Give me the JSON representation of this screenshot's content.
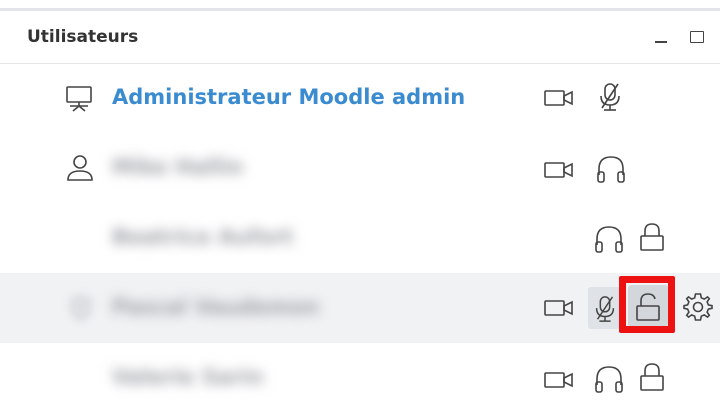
{
  "panel": {
    "title": "Utilisateurs",
    "controls": {
      "minimize": "minimize-icon",
      "maximize": "maximize-icon"
    }
  },
  "users": [
    {
      "name": "Administrateur Moodle admin",
      "role_icon": "presenter-icon",
      "name_visible": true,
      "actions": [
        "camera-icon",
        "microphone-muted-icon"
      ]
    },
    {
      "name": "Mike Hallin",
      "role_icon": "user-icon",
      "name_visible": false,
      "actions": [
        "camera-icon",
        "headphones-icon"
      ]
    },
    {
      "name": "Beatrice Aufort",
      "role_icon": "",
      "name_visible": false,
      "actions": [
        "headphones-icon",
        "lock-icon"
      ]
    },
    {
      "name": "Pascal Vaudemon",
      "role_icon": "shield-icon",
      "name_visible": false,
      "actions": [
        "camera-icon",
        "microphone-muted-icon",
        "unlock-icon",
        "gear-icon"
      ]
    },
    {
      "name": "Valerie Sarin",
      "role_icon": "",
      "name_visible": false,
      "actions": [
        "camera-icon",
        "headphones-icon",
        "lock-icon"
      ]
    }
  ],
  "colors": {
    "presenter_name": "#3a8bd0",
    "highlight_row": "#f1f2f4",
    "annotation_frame": "#ee1111"
  }
}
